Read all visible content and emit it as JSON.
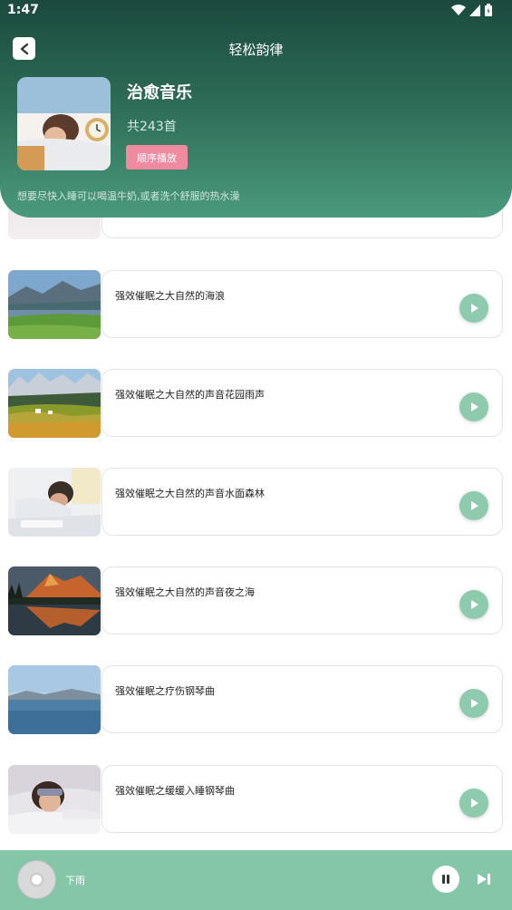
{
  "status_bar": {
    "time": "1:47",
    "icons": [
      "wifi-icon",
      "signal-icon",
      "battery-icon"
    ]
  },
  "header": {
    "title": "轻松韵律",
    "album_title": "治愈音乐",
    "count": "共243首",
    "order_button": "顺序播放",
    "tip": "想要尽快入睡可以喝温牛奶,或者洗个舒服的热水澡"
  },
  "tracks": [
    {
      "name": "强效催眠之大自然的海浪"
    },
    {
      "name": "强效催眠之大自然的声音花园雨声"
    },
    {
      "name": "强效催眠之大自然的声音水面森林"
    },
    {
      "name": "强效催眠之大自然的声音夜之海"
    },
    {
      "name": "强效催眠之疗伤钢琴曲"
    },
    {
      "name": "强效催眠之缓缓入睡钢琴曲"
    }
  ],
  "player": {
    "now_playing": "下雨"
  },
  "colors": {
    "header_dark": "#1b4a3e",
    "accent": "#85c6a8",
    "play_button": "#8ecaae",
    "order_button": "#f08aa0"
  }
}
